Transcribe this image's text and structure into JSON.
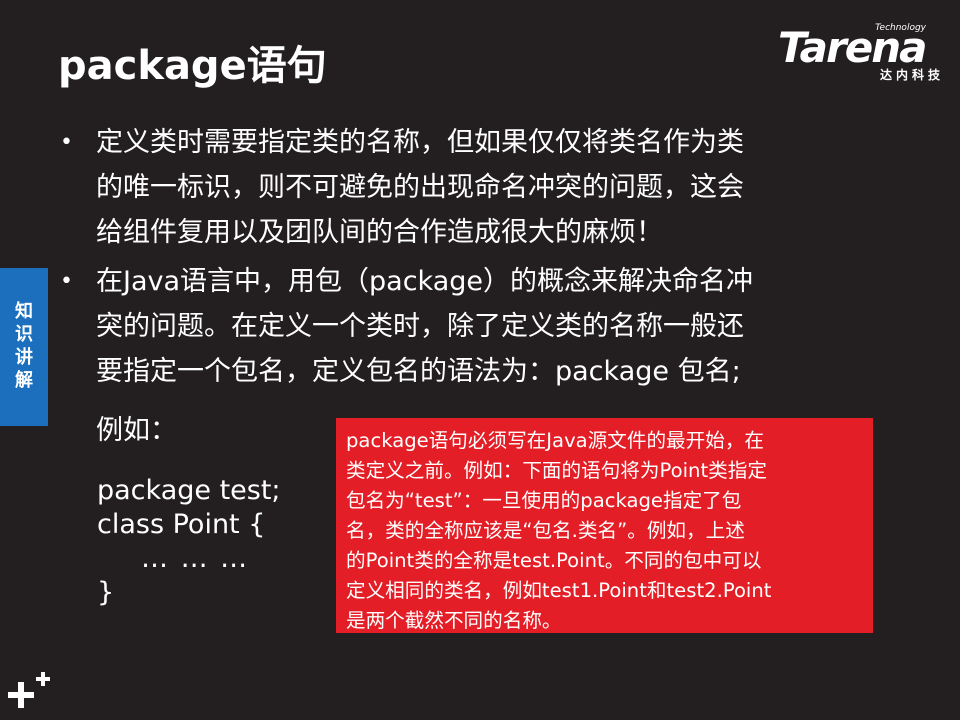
{
  "slide": {
    "title": "package语句",
    "logo": {
      "small": "Technology",
      "word": "Tarena",
      "sub": "达内科技"
    },
    "side_tab": "知识讲解",
    "bullets": [
      {
        "lines": [
          "定义类时需要指定类的名称，但如果仅仅将类名作为类",
          "的唯一标识，则不可避免的出现命名冲突的问题，这会",
          "给组件复用以及团队间的合作造成很大的麻烦！"
        ]
      },
      {
        "lines": [
          "在Java语言中，用包（package）的概念来解决命名冲",
          "突的问题。在定义一个类时，除了定义类的名称一般还",
          "要指定一个包名，定义包名的语法为：package 包名;"
        ]
      }
    ],
    "example_label": "例如：",
    "code": [
      "package test;",
      "class Point {",
      "… … …",
      "}"
    ],
    "note": [
      "package语句必须写在Java源文件的最开始，在",
      "类定义之前。例如：下面的语句将为Point类指定",
      "包名为“test”：一旦使用的package指定了包",
      "名，类的全称应该是“包名.类名”。例如，上述",
      "的Point类的全称是test.Point。不同的包中可以",
      "定义相同的类名，例如test1.Point和test2.Point",
      "是两个截然不同的名称。"
    ],
    "colors": {
      "background": "#231f20",
      "note_background": "#e31e26",
      "side_tab": "#1b6fbd",
      "text": "#ffffff"
    },
    "icons": {
      "bullet": "bullet-dot-icon",
      "corner": "plus-marks-icon"
    }
  }
}
